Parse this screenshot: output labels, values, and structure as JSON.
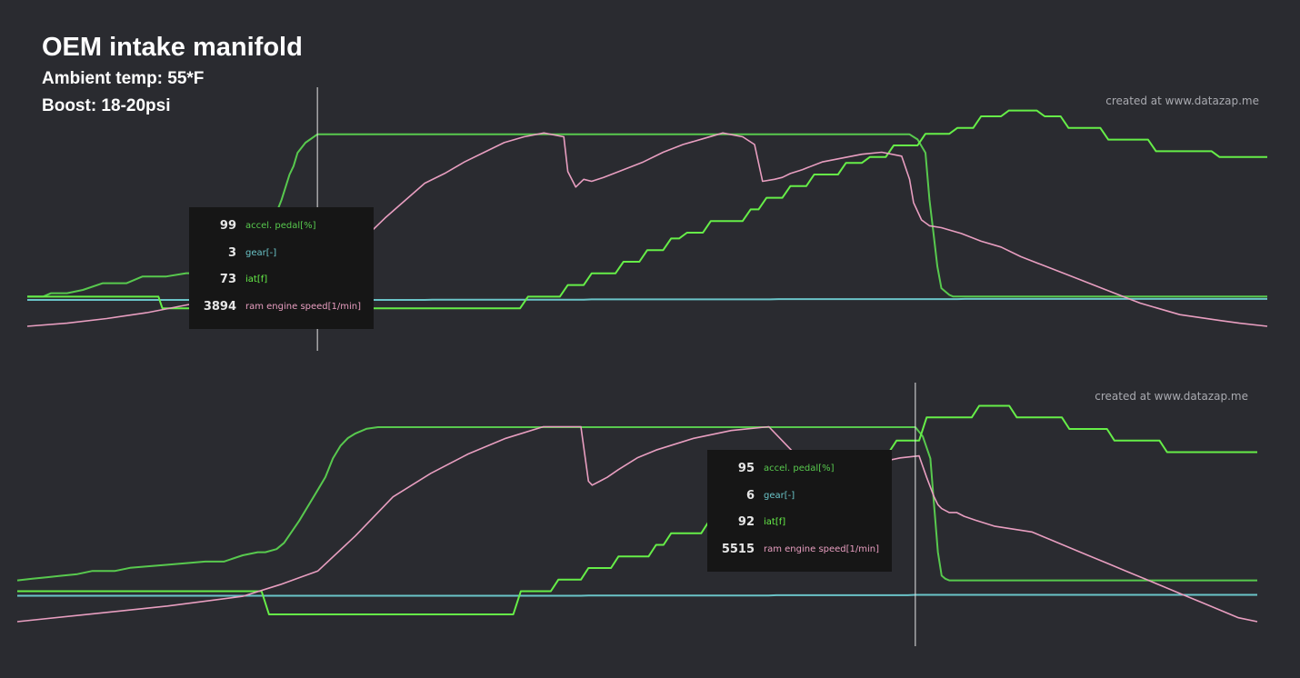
{
  "header": {
    "title": "OEM intake manifold",
    "ambient": "Ambient temp: 55*F",
    "boost": "Boost: 18-20psi"
  },
  "credit": "created at www.datazap.me",
  "colors": {
    "background": "#2a2b30",
    "accel": "#58c94e",
    "gear": "#6ac4c8",
    "iat": "#66ee48",
    "rpm": "#e89ec0",
    "cursor": "#e6e6e6",
    "tooltip_bg": "#161616"
  },
  "chart_data": [
    {
      "type": "line",
      "title": "",
      "cursor_x": 73,
      "tooltip": {
        "rows": [
          {
            "value": "99",
            "label": "accel. pedal[%]",
            "color": "#58c94e"
          },
          {
            "value": "3",
            "label": "gear[-]",
            "color": "#6ac4c8"
          },
          {
            "value": "73",
            "label": "iat[f]",
            "color": "#66ee48"
          },
          {
            "value": "3894",
            "label": "ram engine speed[1/min]",
            "color": "#e89ec0"
          }
        ]
      },
      "series": [
        {
          "key": "accel",
          "ylim": [
            0,
            100
          ],
          "x": [
            0,
            4,
            6,
            10,
            14,
            19,
            25,
            29,
            32,
            35,
            40,
            45,
            50,
            55,
            60,
            62,
            64,
            66,
            67,
            68,
            70,
            73,
            220,
            222,
            224,
            226,
            227,
            228,
            229,
            230,
            232,
            233,
            234,
            235,
            236,
            237,
            312
          ],
          "y": [
            2,
            2,
            4,
            4,
            6,
            10,
            10,
            14,
            14,
            14,
            16,
            16,
            18,
            24,
            36,
            48,
            60,
            75,
            80,
            88,
            94,
            99,
            99,
            99,
            96,
            88,
            60,
            40,
            20,
            7,
            3,
            2,
            2,
            2,
            2,
            2,
            2
          ]
        },
        {
          "key": "gear",
          "ylim": [
            0,
            6
          ],
          "x": [
            0,
            100,
            102,
            140,
            142,
            187,
            189,
            234,
            236,
            312
          ],
          "y": [
            3,
            3,
            3.1,
            3.1,
            3.2,
            3.2,
            3.3,
            3.3,
            3.35,
            3.35
          ]
        },
        {
          "key": "iat",
          "ylim": [
            60,
            100
          ],
          "x": [
            0,
            33,
            34,
            124,
            126,
            134,
            136,
            140,
            142,
            148,
            150,
            154,
            156,
            160,
            162,
            164,
            166,
            170,
            172,
            180,
            182,
            184,
            186,
            190,
            192,
            196,
            198,
            204,
            206,
            210,
            212,
            216,
            218,
            224,
            226,
            232,
            234,
            238,
            240,
            245,
            247,
            254,
            256,
            260,
            262,
            270,
            272,
            282,
            284,
            298,
            300,
            312
          ],
          "y": [
            64,
            64,
            62,
            62,
            64,
            64,
            66,
            66,
            68,
            68,
            70,
            70,
            72,
            72,
            74,
            74,
            75,
            75,
            77,
            77,
            79,
            79,
            81,
            81,
            83,
            83,
            85,
            85,
            87,
            87,
            88,
            88,
            90,
            90,
            92,
            92,
            93,
            93,
            95,
            95,
            96,
            96,
            95,
            95,
            93,
            93,
            91,
            91,
            89,
            89,
            88,
            88
          ]
        },
        {
          "key": "rpm",
          "ylim": [
            1500,
            7000
          ],
          "x": [
            0,
            10,
            20,
            30,
            40,
            50,
            60,
            70,
            73,
            80,
            90,
            100,
            105,
            110,
            115,
            120,
            125,
            130,
            135,
            136,
            138,
            140,
            142,
            145,
            150,
            155,
            160,
            165,
            170,
            175,
            180,
            183,
            185,
            188,
            190,
            192,
            195,
            200,
            210,
            215,
            220,
            222,
            223,
            225,
            227,
            230,
            235,
            240,
            245,
            250,
            255,
            260,
            265,
            270,
            275,
            280,
            290,
            300,
            305,
            312
          ],
          "y": [
            1500,
            1580,
            1700,
            1850,
            2050,
            2250,
            2450,
            2650,
            2800,
            3300,
            4300,
            5200,
            5450,
            5750,
            6000,
            6250,
            6400,
            6500,
            6400,
            5500,
            5100,
            5300,
            5250,
            5350,
            5550,
            5750,
            6000,
            6200,
            6350,
            6500,
            6400,
            6200,
            5250,
            5300,
            5350,
            5450,
            5550,
            5750,
            5950,
            6000,
            5900,
            5300,
            4700,
            4250,
            4100,
            4050,
            3900,
            3700,
            3550,
            3300,
            3100,
            2900,
            2700,
            2500,
            2300,
            2100,
            1800,
            1650,
            1580,
            1500
          ]
        }
      ]
    },
    {
      "type": "line",
      "title": "",
      "cursor_x": 239,
      "tooltip": {
        "rows": [
          {
            "value": "95",
            "label": "accel. pedal[%]",
            "color": "#58c94e"
          },
          {
            "value": "6",
            "label": "gear[-]",
            "color": "#6ac4c8"
          },
          {
            "value": "92",
            "label": "iat[f]",
            "color": "#66ee48"
          },
          {
            "value": "5515",
            "label": "ram engine speed[1/min]",
            "color": "#e89ec0"
          }
        ]
      },
      "series": [
        {
          "key": "accel",
          "ylim": [
            0,
            100
          ],
          "x": [
            0,
            4,
            8,
            12,
            16,
            20,
            26,
            30,
            40,
            50,
            55,
            60,
            64,
            66,
            69,
            71,
            75,
            78,
            80,
            82,
            84,
            86,
            88,
            90,
            93,
            96,
            97,
            98,
            100,
            102,
            103,
            104,
            239,
            241,
            243,
            244,
            245,
            246,
            247,
            248,
            249,
            330
          ],
          "y": [
            2,
            3,
            4,
            5,
            6,
            8,
            8,
            10,
            12,
            14,
            14,
            18,
            20,
            20,
            22,
            26,
            40,
            52,
            60,
            68,
            80,
            88,
            93,
            96,
            99,
            100,
            100,
            100,
            100,
            100,
            100,
            100,
            100,
            94,
            80,
            50,
            20,
            5,
            3,
            2,
            2,
            2
          ]
        },
        {
          "key": "gear",
          "ylim": [
            0,
            6
          ],
          "x": [
            0,
            150,
            152,
            200,
            202,
            237,
            239,
            330
          ],
          "y": [
            3,
            3,
            3.1,
            3.1,
            3.2,
            3.2,
            3.3,
            3.3
          ]
        },
        {
          "key": "iat",
          "ylim": [
            60,
            100
          ],
          "x": [
            0,
            65,
            67,
            132,
            134,
            142,
            144,
            150,
            152,
            158,
            160,
            168,
            170,
            172,
            174,
            182,
            184,
            188,
            190,
            202,
            204,
            210,
            212,
            216,
            218,
            222,
            224,
            232,
            234,
            240,
            242,
            254,
            256,
            264,
            266,
            278,
            280,
            290,
            292,
            304,
            306,
            330
          ],
          "y": [
            64,
            64,
            60,
            60,
            64,
            64,
            66,
            66,
            68,
            68,
            70,
            70,
            72,
            72,
            74,
            74,
            76,
            76,
            78,
            78,
            82,
            82,
            84,
            84,
            86,
            86,
            88,
            88,
            90,
            90,
            94,
            94,
            96,
            96,
            94,
            94,
            92,
            92,
            90,
            90,
            88,
            88
          ]
        },
        {
          "key": "rpm",
          "ylim": [
            1500,
            7000
          ],
          "x": [
            0,
            20,
            40,
            60,
            70,
            80,
            90,
            100,
            110,
            120,
            130,
            140,
            150,
            152,
            153,
            155,
            157,
            160,
            165,
            170,
            180,
            190,
            200,
            205,
            208,
            210,
            230,
            235,
            240,
            242,
            244,
            245,
            246,
            248,
            250,
            252,
            255,
            260,
            270,
            275,
            280,
            285,
            290,
            295,
            300,
            305,
            310,
            315,
            320,
            325,
            330
          ],
          "y": [
            1500,
            1700,
            1900,
            2150,
            2450,
            2800,
            3700,
            4700,
            5300,
            5800,
            6200,
            6500,
            6500,
            5100,
            5000,
            5100,
            5200,
            5400,
            5700,
            5900,
            6200,
            6400,
            6500,
            6000,
            5700,
            5600,
            5600,
            5700,
            5750,
            5200,
            4700,
            4500,
            4400,
            4300,
            4300,
            4200,
            4100,
            3950,
            3800,
            3600,
            3400,
            3200,
            3000,
            2800,
            2600,
            2400,
            2200,
            2000,
            1800,
            1600,
            1500
          ]
        }
      ]
    }
  ]
}
